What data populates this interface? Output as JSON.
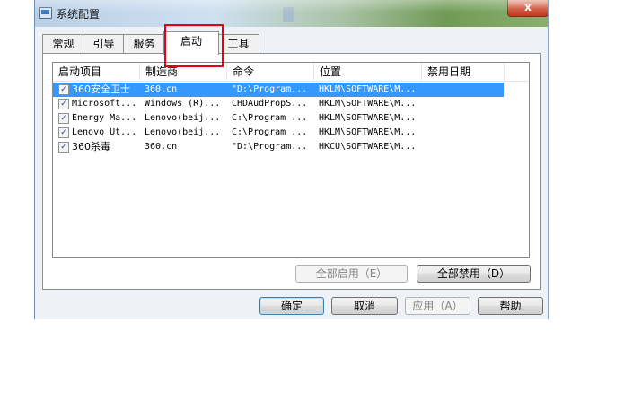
{
  "window": {
    "title": "系统配置",
    "close_glyph": "x"
  },
  "tabs": [
    {
      "label": "常规"
    },
    {
      "label": "引导"
    },
    {
      "label": "服务"
    },
    {
      "label": "启动",
      "active": true
    },
    {
      "label": "工具"
    }
  ],
  "table": {
    "columns": [
      "启动项目",
      "制造商",
      "命令",
      "位置",
      "禁用日期"
    ],
    "rows": [
      {
        "checked": true,
        "selected": true,
        "cells": [
          "360安全卫士",
          "360.cn",
          "\"D:\\Program...",
          "HKLM\\SOFTWARE\\M...",
          ""
        ]
      },
      {
        "checked": true,
        "selected": false,
        "cells": [
          "Microsoft...",
          "Windows (R)...",
          "CHDAudPropS...",
          "HKLM\\SOFTWARE\\M...",
          ""
        ]
      },
      {
        "checked": true,
        "selected": false,
        "cells": [
          "Energy Ma...",
          "Lenovo(beij...",
          "C:\\Program ...",
          "HKLM\\SOFTWARE\\M...",
          ""
        ]
      },
      {
        "checked": true,
        "selected": false,
        "cells": [
          "Lenovo Ut...",
          "Lenovo(beij...",
          "C:\\Program ...",
          "HKLM\\SOFTWARE\\M...",
          ""
        ]
      },
      {
        "checked": true,
        "selected": false,
        "cells": [
          "360杀毒",
          "360.cn",
          "\"D:\\Program...",
          "HKCU\\SOFTWARE\\M...",
          ""
        ]
      }
    ]
  },
  "buttons": {
    "enable_all": "全部启用（E）",
    "disable_all": "全部禁用（D）",
    "ok": "确定",
    "cancel": "取消",
    "apply": "应用（A）",
    "help": "帮助"
  },
  "colors": {
    "selection": "#3399ff",
    "highlight_box": "#e60012"
  }
}
